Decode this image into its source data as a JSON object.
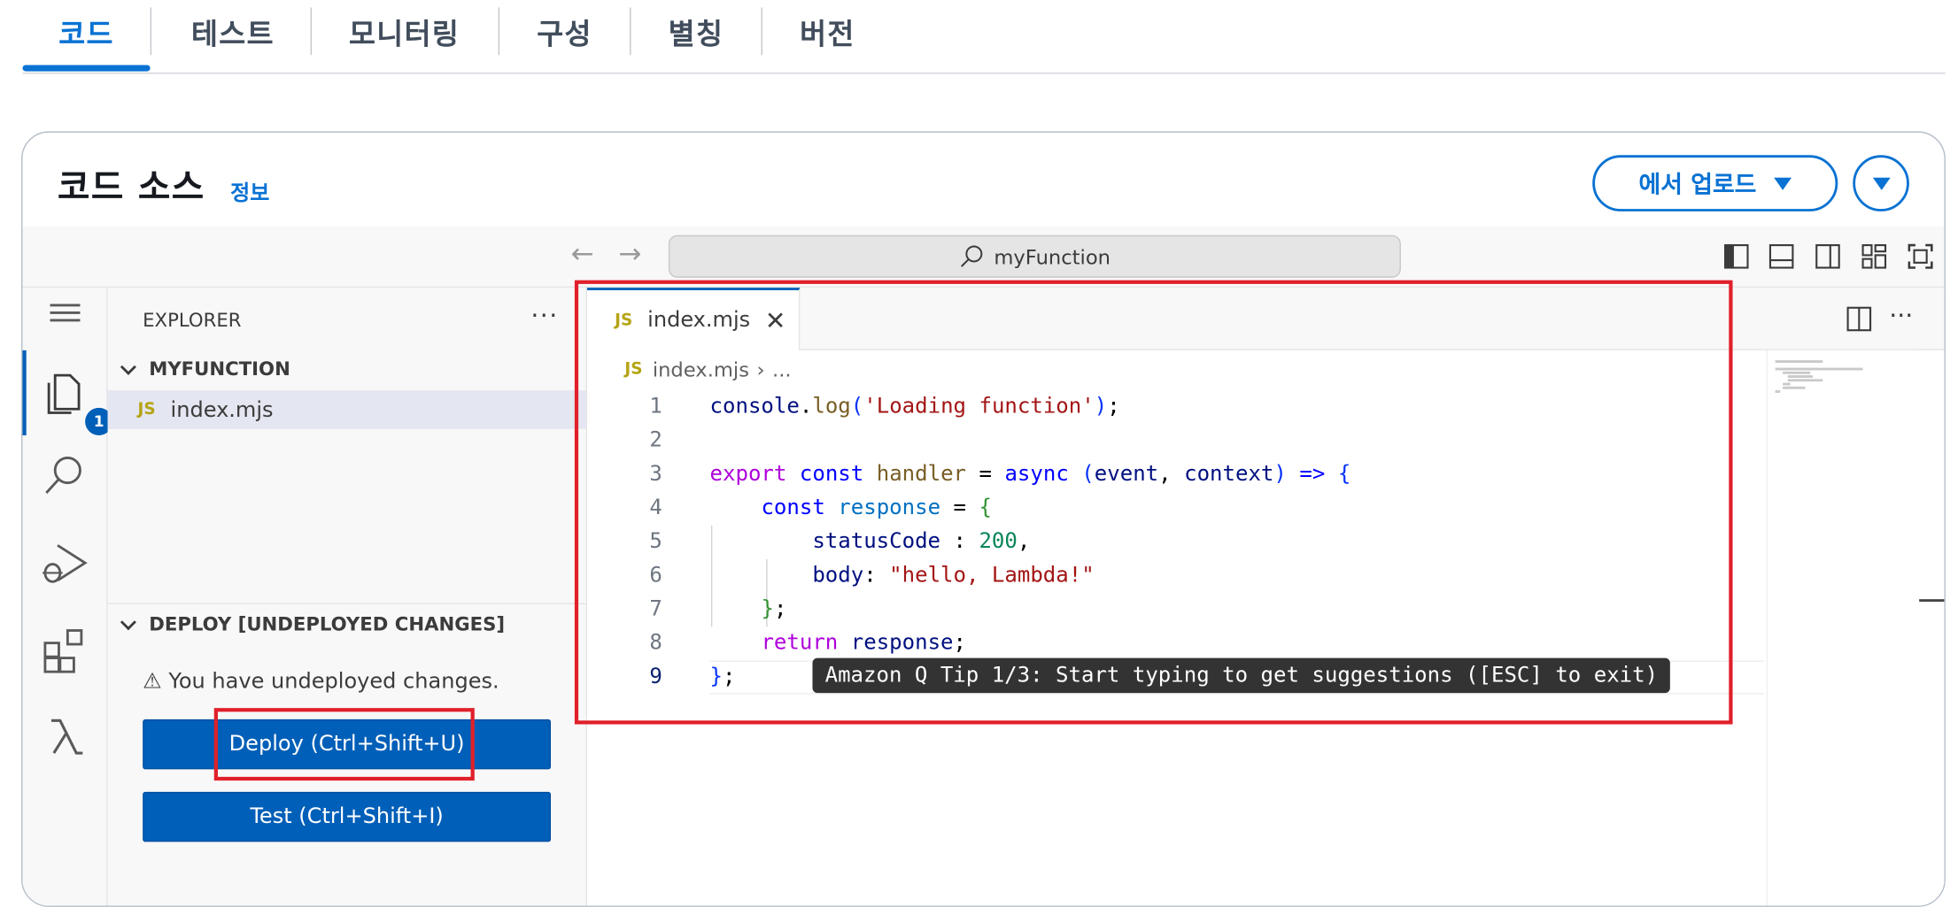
{
  "tabs": [
    "코드",
    "테스트",
    "모니터링",
    "구성",
    "별칭",
    "버전"
  ],
  "card": {
    "title": "코드 소스",
    "info": "정보",
    "upload_label": "에서 업로드"
  },
  "ide": {
    "search": "myFunction",
    "explorer_title": "EXPLORER",
    "folder": "MYFUNCTION",
    "badge": "1",
    "deploy_section": "DEPLOY [UNDEPLOYED CHANGES]",
    "warning": "⚠ You have undeployed changes.",
    "deploy_button": "Deploy (Ctrl+Shift+U)",
    "test_button": "Test (Ctrl+Shift+I)"
  },
  "editor": {
    "file_icon": "JS",
    "file_name": "index.mjs",
    "breadcrumb_rest": "...",
    "line_numbers": [
      "1",
      "2",
      "3",
      "4",
      "5",
      "6",
      "7",
      "8",
      "9"
    ],
    "current_line": "9",
    "tip": "Amazon Q Tip 1/3: Start typing to get suggestions ([ESC] to exit)"
  },
  "colors": {
    "accent": "#0972d3",
    "deploy": "#005fb8",
    "highlight": "#e0202a"
  }
}
